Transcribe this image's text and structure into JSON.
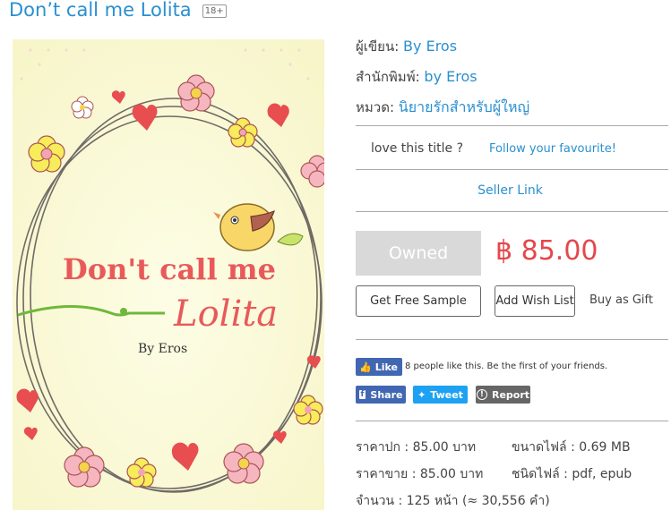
{
  "header": {
    "title": "Don’t call me Lolita",
    "age_badge": "18+"
  },
  "cover": {
    "title_line1": "Don't call me",
    "title_line2": "Lolita",
    "byline": "By Eros"
  },
  "info": {
    "author_label": "ผู้เขียน: ",
    "author": "By Eros",
    "publisher_label": "สำนักพิมพ์: ",
    "publisher": "by Eros",
    "category_label": "หมวด: ",
    "category": "นิยายรักสำหรับผู้ใหญ่"
  },
  "follow": {
    "prompt": "love this title ?",
    "link": "Follow your favourite!"
  },
  "seller_link": "Seller Link",
  "purchase": {
    "owned_label": "Owned",
    "price": "฿ 85.00",
    "sample_label": "Get Free Sample",
    "wishlist_label": "Add Wish List",
    "gift_label": "Buy as Gift"
  },
  "social": {
    "like_label": "Like",
    "like_text": "8 people like this. Be the first of your friends.",
    "share_label": "Share",
    "tweet_label": "Tweet",
    "report_label": "Report"
  },
  "details": {
    "cover_price": "ราคาปก : 85.00 บาท",
    "file_size": "ขนาดไฟล์ : 0.69 MB",
    "sale_price": "ราคาขาย : 85.00 บาท",
    "file_type": "ชนิดไฟล์ : pdf, epub",
    "pages": "จำนวน : 125 หน้า (≈ 30,556 คำ)"
  },
  "colors": {
    "link_blue": "#2a8fd0",
    "price_red": "#e4474b",
    "facebook": "#4267b2",
    "twitter": "#1da1f2",
    "report": "#666666"
  }
}
